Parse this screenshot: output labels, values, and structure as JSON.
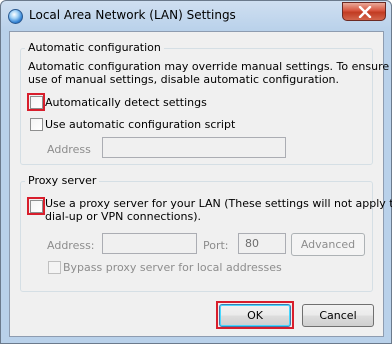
{
  "window": {
    "title": "Local Area Network (LAN) Settings",
    "app_icon": "network-globe-icon",
    "close_icon": "close-icon"
  },
  "auto_config": {
    "group_label": "Automatic configuration",
    "description_line1": "Automatic configuration may override manual settings.  To ensure the",
    "description_line2": "use of manual settings, disable automatic configuration.",
    "detect_settings_label": "Automatically detect settings",
    "detect_settings_checked": false,
    "use_script_label": "Use automatic configuration script",
    "use_script_checked": false,
    "address_label": "Address",
    "address_value": ""
  },
  "proxy": {
    "group_label": "Proxy server",
    "use_proxy_label_line1": "Use a proxy server for your LAN (These settings will not apply to",
    "use_proxy_label_line2": "dial-up or VPN connections).",
    "use_proxy_checked": false,
    "address_label": "Address:",
    "address_value": "",
    "port_label": "Port:",
    "port_value": "80",
    "advanced_label": "Advanced",
    "bypass_label": "Bypass proxy server for local addresses",
    "bypass_checked": false
  },
  "buttons": {
    "ok_label": "OK",
    "cancel_label": "Cancel"
  },
  "colors": {
    "highlight": "#d81e2c",
    "window_frame": "#b9d1ea",
    "dialog_background": "#f0f0f0"
  }
}
